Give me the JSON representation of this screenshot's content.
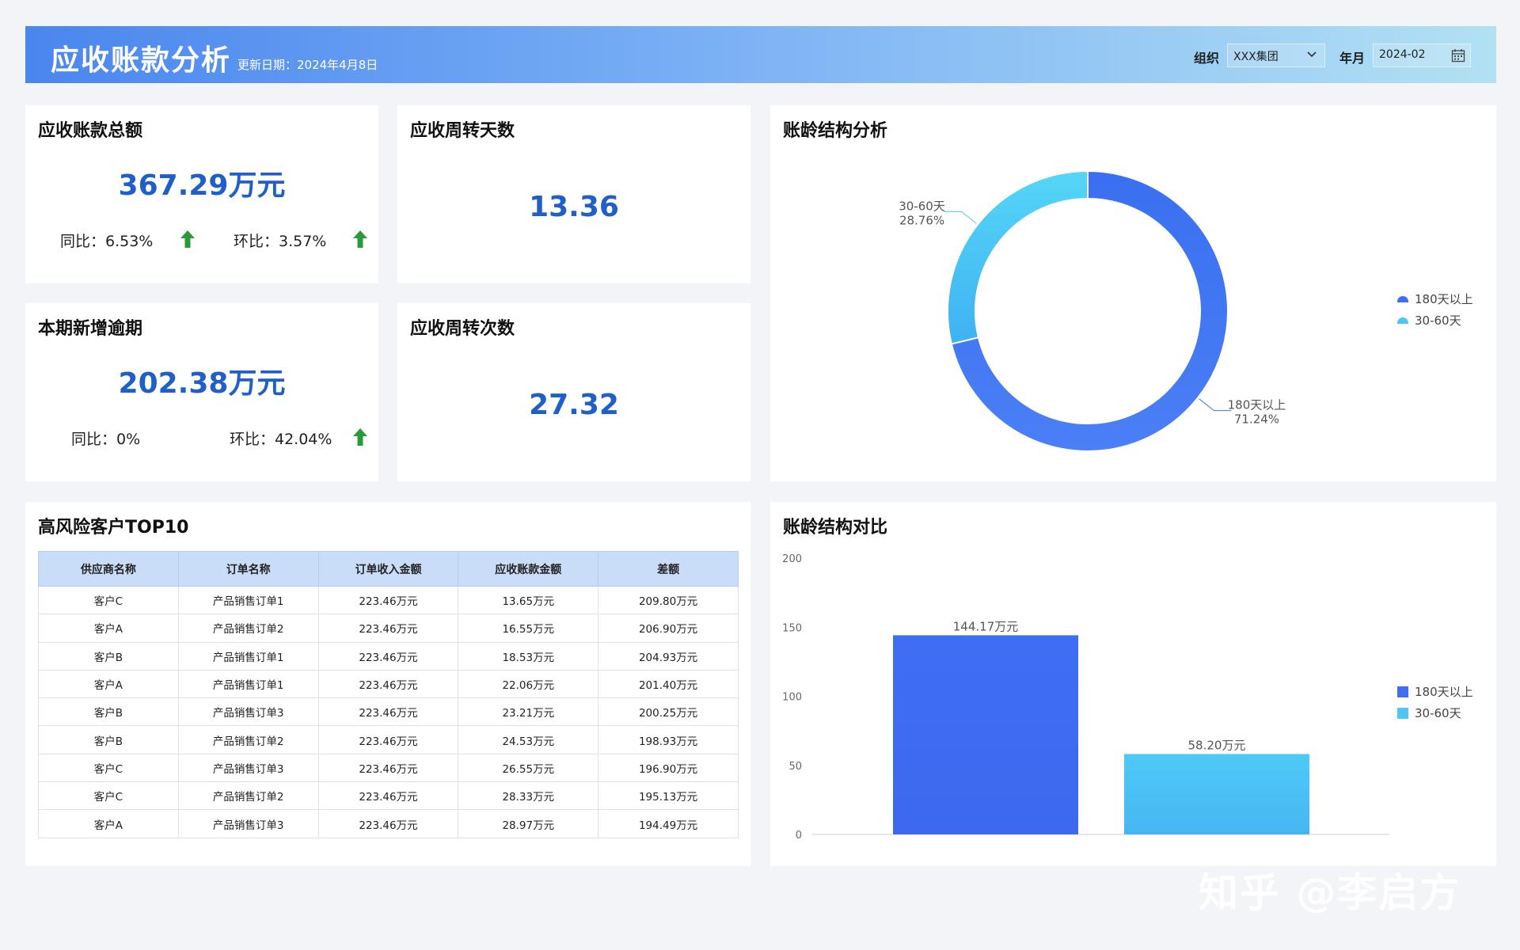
{
  "header": {
    "title": "应收账款分析",
    "update_date": "更新日期：2024年4月8日",
    "org_label": "组织",
    "org_value": "XXX集团",
    "month_label": "年月",
    "month_value": "2024-02"
  },
  "kpis": {
    "total": {
      "title": "应收账款总额",
      "value": "367.29万元",
      "yoy": "同比：6.53%",
      "mom": "环比：3.57%"
    },
    "turnover_days": {
      "title": "应收周转天数",
      "value": "13.36"
    },
    "new_overdue": {
      "title": "本期新增逾期",
      "value": "202.38万元",
      "yoy": "同比：0%",
      "mom": "环比：42.04%"
    },
    "turnover_times": {
      "title": "应收周转次数",
      "value": "27.32"
    }
  },
  "risk_table": {
    "title": "高风险客户TOP10",
    "columns": [
      "供应商名称",
      "订单名称",
      "订单收入金额",
      "应收账款金额",
      "差额"
    ],
    "rows": [
      [
        "客户C",
        "产品销售订单1",
        "223.46万元",
        "13.65万元",
        "209.80万元"
      ],
      [
        "客户A",
        "产品销售订单2",
        "223.46万元",
        "16.55万元",
        "206.90万元"
      ],
      [
        "客户B",
        "产品销售订单1",
        "223.46万元",
        "18.53万元",
        "204.93万元"
      ],
      [
        "客户A",
        "产品销售订单1",
        "223.46万元",
        "22.06万元",
        "201.40万元"
      ],
      [
        "客户B",
        "产品销售订单3",
        "223.46万元",
        "23.21万元",
        "200.25万元"
      ],
      [
        "客户B",
        "产品销售订单2",
        "223.46万元",
        "24.53万元",
        "198.93万元"
      ],
      [
        "客户C",
        "产品销售订单3",
        "223.46万元",
        "26.55万元",
        "196.90万元"
      ],
      [
        "客户C",
        "产品销售订单2",
        "223.46万元",
        "28.33万元",
        "195.13万元"
      ],
      [
        "客户A",
        "产品销售订单3",
        "223.46万元",
        "28.97万元",
        "194.49万元"
      ]
    ]
  },
  "colors": {
    "series1": "#3f6ef5",
    "series2": "#4fc6f5",
    "kpi": "#1f5fc7",
    "up_arrow": "#2a9a3a"
  },
  "chart_data": [
    {
      "type": "pie",
      "title": "账龄结构分析",
      "slices": [
        {
          "name": "180天以上",
          "value": 71.24,
          "label": "71.24%"
        },
        {
          "name": "30-60天",
          "value": 28.76,
          "label": "28.76%"
        }
      ],
      "donut": true,
      "legend": "right"
    },
    {
      "type": "bar",
      "title": "账龄结构对比",
      "categories": [
        "180天以上",
        "30-60天"
      ],
      "values": [
        144.17,
        58.2
      ],
      "data_labels": [
        "144.17万元",
        "58.20万元"
      ],
      "ylim": [
        0,
        200
      ],
      "yticks": [
        0,
        50,
        100,
        150,
        200
      ],
      "legend": "right",
      "grid": false
    }
  ],
  "watermark": "知乎 @李启方"
}
